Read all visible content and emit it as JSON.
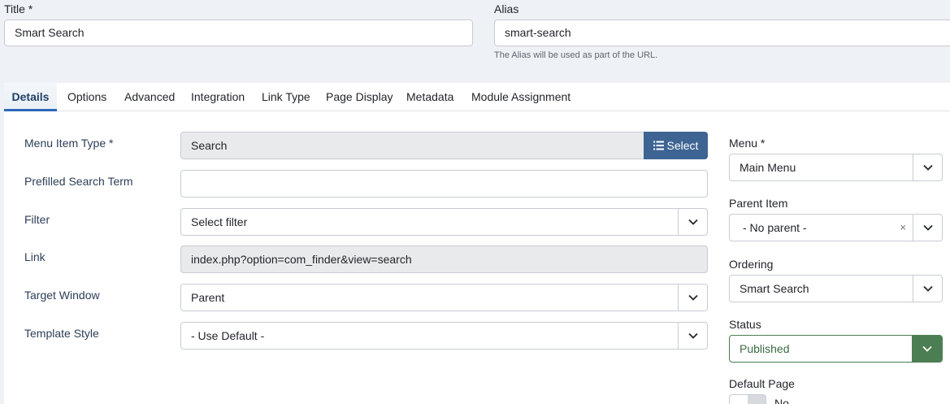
{
  "header": {
    "title_label": "Title *",
    "title_value": "Smart Search",
    "alias_label": "Alias",
    "alias_value": "smart-search",
    "alias_hint": "The Alias will be used as part of the URL."
  },
  "tabs": [
    {
      "label": "Details",
      "active": true
    },
    {
      "label": "Options"
    },
    {
      "label": "Advanced"
    },
    {
      "label": "Integration"
    },
    {
      "label": "Link Type"
    },
    {
      "label": "Page Display"
    },
    {
      "label": "Metadata"
    },
    {
      "label": "Module Assignment"
    }
  ],
  "details": {
    "menu_item_type": {
      "label": "Menu Item Type *",
      "value": "Search",
      "button": "Select"
    },
    "prefilled_search_term": {
      "label": "Prefilled Search Term",
      "value": ""
    },
    "filter": {
      "label": "Filter",
      "value": "Select filter"
    },
    "link": {
      "label": "Link",
      "value": "index.php?option=com_finder&view=search"
    },
    "target_window": {
      "label": "Target Window",
      "value": "Parent"
    },
    "template_style": {
      "label": "Template Style",
      "value": "- Use Default -"
    }
  },
  "sidebar": {
    "menu": {
      "label": "Menu *",
      "value": "Main Menu"
    },
    "parent_item": {
      "label": "Parent Item",
      "value": "- No parent -",
      "clear": "×"
    },
    "ordering": {
      "label": "Ordering",
      "value": "Smart Search"
    },
    "status": {
      "label": "Status",
      "value": "Published"
    },
    "default_page": {
      "label": "Default Page",
      "value": "No"
    }
  },
  "colors": {
    "accent": "#2a69b8",
    "select_button": "#3e6494",
    "status_published": "#4b7e52"
  },
  "icons": {
    "chevron": "chevron-down-icon",
    "list": "list-icon"
  }
}
